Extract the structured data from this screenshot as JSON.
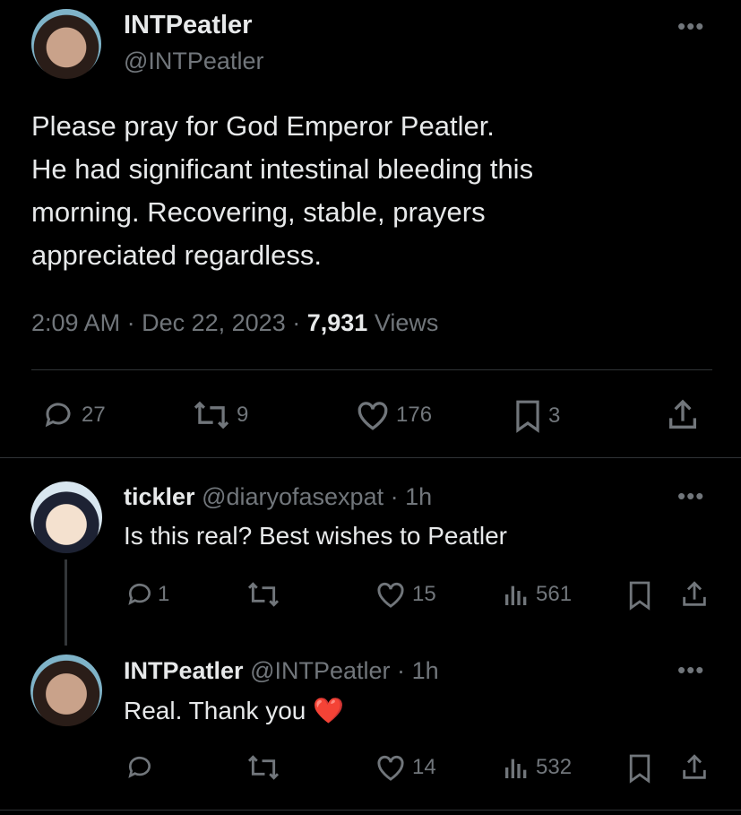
{
  "main_post": {
    "display_name": "INTPeatler",
    "handle": "@INTPeatler",
    "text_lines": [
      "Please pray for God Emperor Peatler.",
      "He had significant intestinal bleeding this",
      "morning. Recovering, stable, prayers",
      "appreciated regardless."
    ],
    "time": "2:09 AM",
    "date": "Dec 22, 2023",
    "views_count": "7,931",
    "views_label": "Views",
    "replies": "27",
    "reposts": "9",
    "likes": "176",
    "bookmarks": "3"
  },
  "replies": [
    {
      "display_name": "tickler",
      "handle": "@diaryofasexpat",
      "age": "1h",
      "text": "Is this real? Best wishes to Peatler",
      "replies": "1",
      "reposts": "",
      "likes": "15",
      "views": "561"
    },
    {
      "display_name": "INTPeatler",
      "handle": "@INTPeatler",
      "age": "1h",
      "text": "Real. Thank you",
      "emoji": "❤️",
      "replies": "",
      "reposts": "",
      "likes": "14",
      "views": "532"
    }
  ],
  "separator": "·",
  "more_icon": "•••",
  "colors": {
    "background": "#000000",
    "text": "#e7e9ea",
    "muted": "#71767b",
    "divider": "#2f3336",
    "heart": "#e0245e"
  },
  "icons": [
    "reply-icon",
    "repost-icon",
    "like-icon",
    "bookmark-icon",
    "share-icon",
    "views-icon",
    "more-icon"
  ]
}
